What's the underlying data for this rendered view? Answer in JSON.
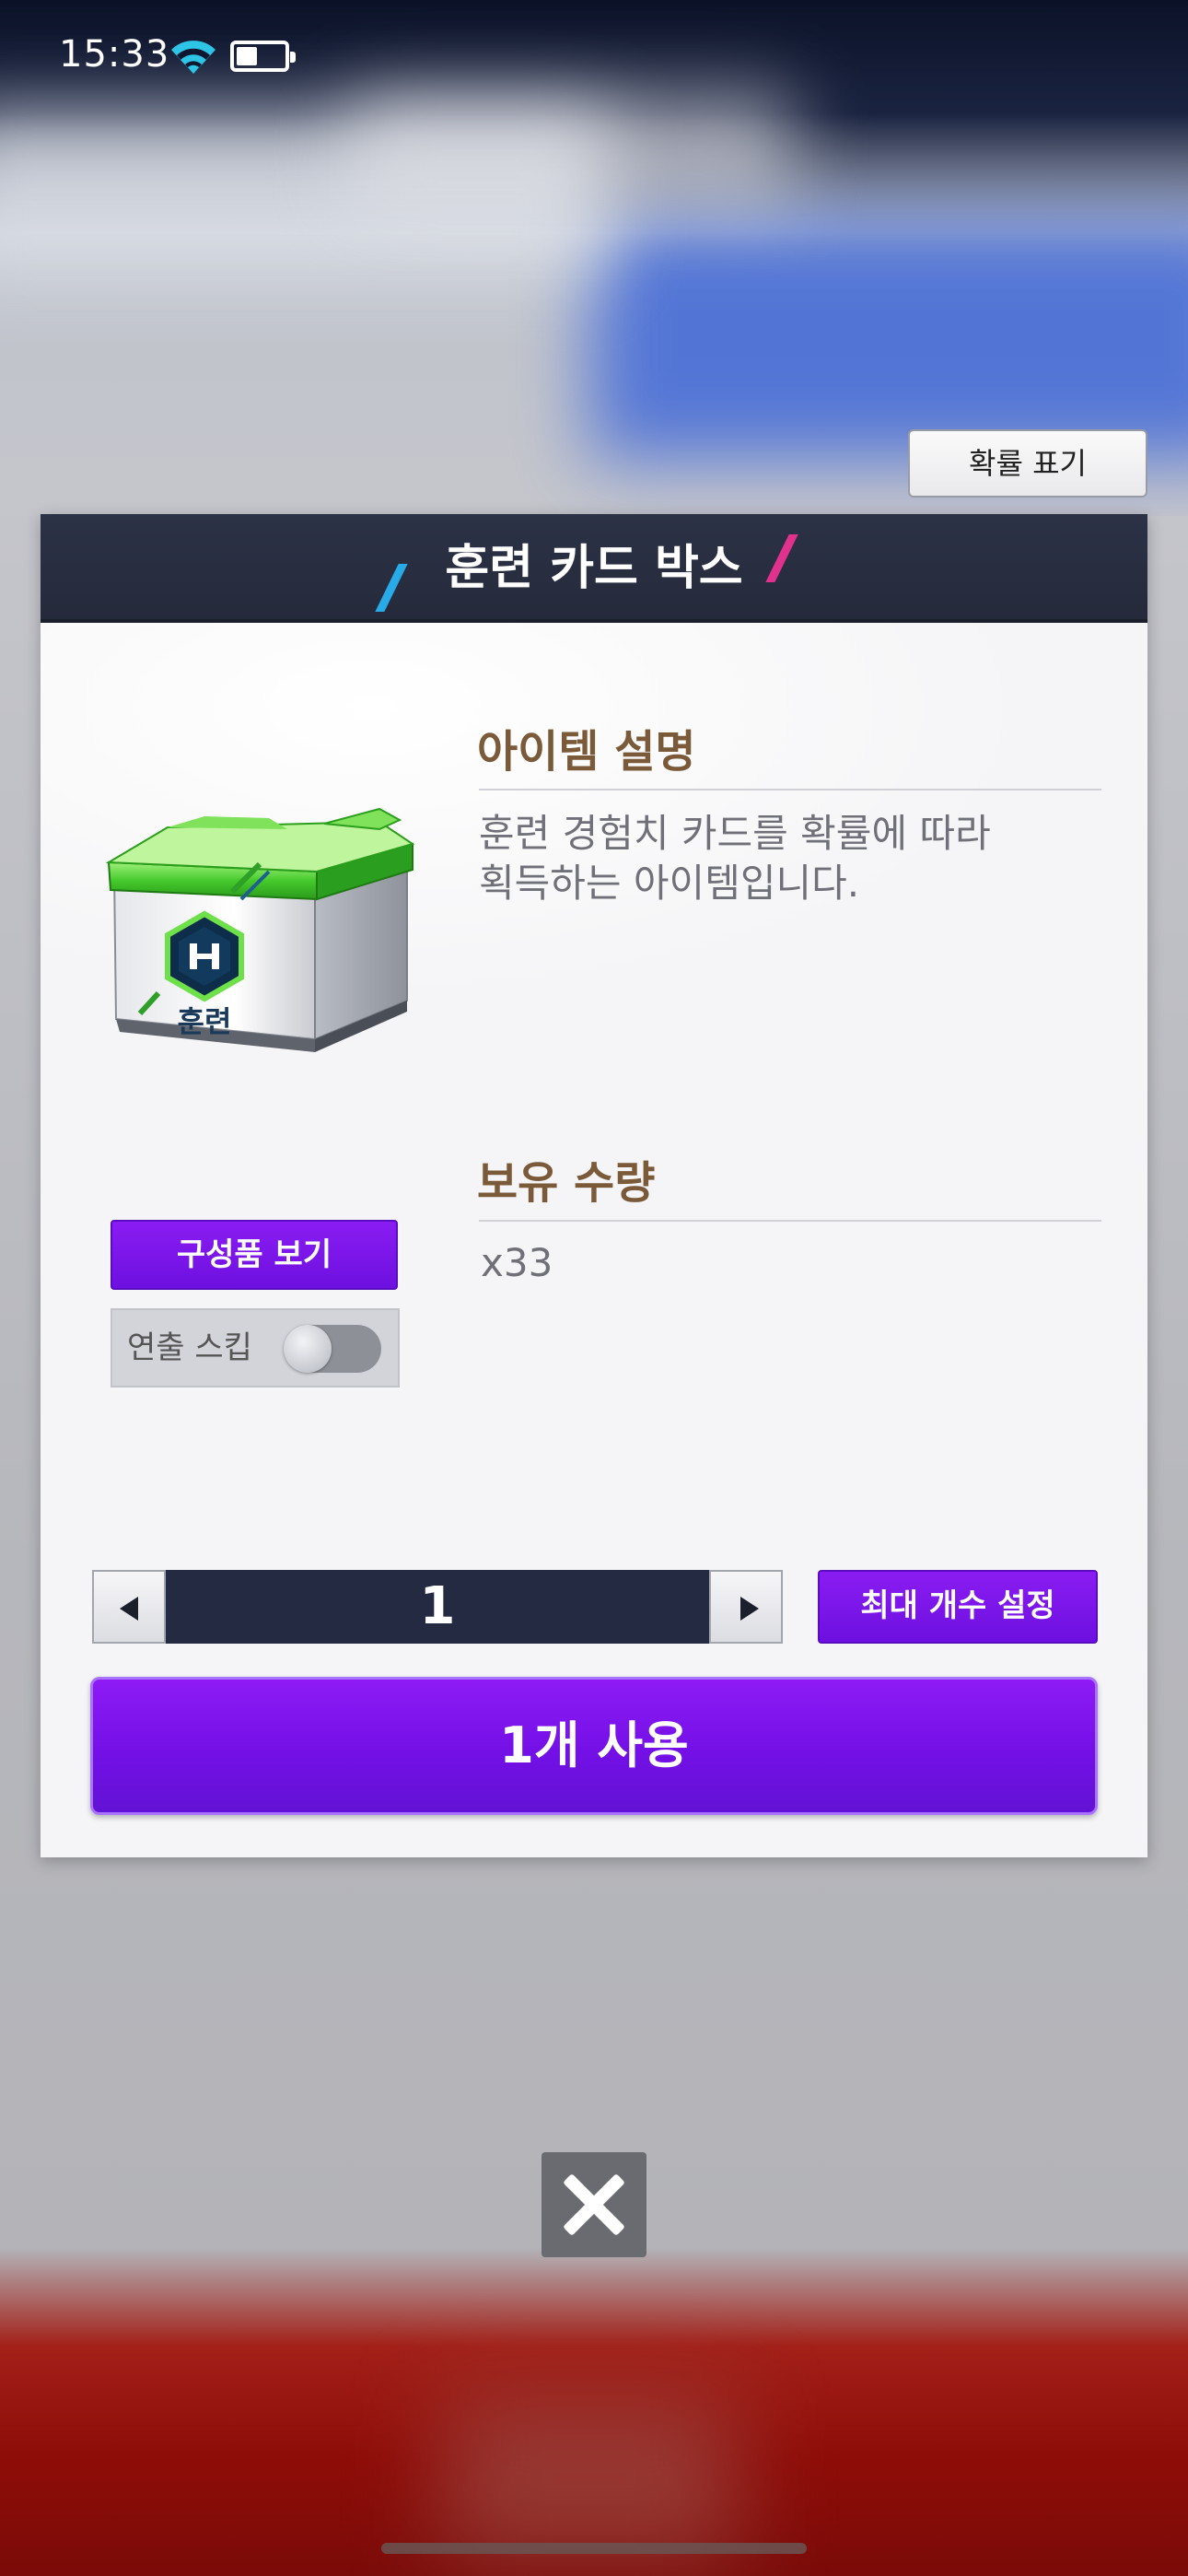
{
  "status_bar": {
    "time": "15:33",
    "wifi_icon": "wifi-icon",
    "battery_icon": "battery-icon"
  },
  "probability_button": {
    "label": "확률 표기"
  },
  "modal": {
    "title": "훈련 카드 박스",
    "item_image": {
      "icon": "training-box-icon",
      "label": "훈련"
    },
    "description": {
      "heading": "아이템 설명",
      "text": "훈련 경험치 카드를 확률에 따라\n획득하는 아이템입니다."
    },
    "owned": {
      "heading": "보유 수량",
      "value": "x33"
    },
    "view_contents_label": "구성품 보기",
    "skip_animation": {
      "label": "연출 스킵",
      "enabled": false
    },
    "quantity": {
      "value": "1"
    },
    "max_button_label": "최대 개수 설정",
    "use_button_label": "1개 사용"
  },
  "close_icon": "close-icon",
  "colors": {
    "accent_purple": "#7a14ec",
    "header_navy": "#252a3b",
    "heading_brown": "#7a5a38"
  }
}
